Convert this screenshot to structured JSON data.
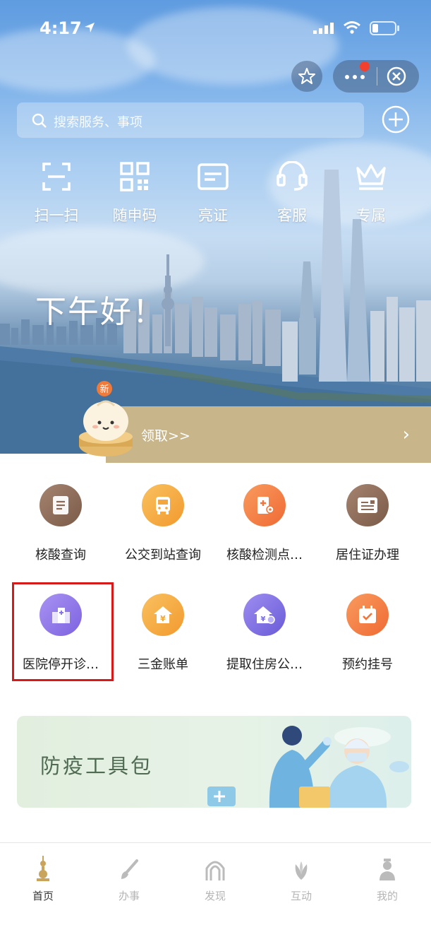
{
  "status_bar": {
    "time": "4:17"
  },
  "search": {
    "placeholder": "搜索服务、事项"
  },
  "quick_actions": [
    {
      "label": "扫一扫",
      "icon": "scan-icon"
    },
    {
      "label": "随申码",
      "icon": "qr-code-icon"
    },
    {
      "label": "亮证",
      "icon": "id-card-icon"
    },
    {
      "label": "客服",
      "icon": "headset-icon"
    },
    {
      "label": "专属",
      "icon": "crown-icon"
    }
  ],
  "greeting": "下午好！",
  "banner": {
    "badge": "新",
    "text": "领取>>",
    "chevron": "›"
  },
  "services": [
    {
      "label": "核酸查询",
      "icon": "document-list-icon",
      "color": "#8b6b57"
    },
    {
      "label": "公交到站查询",
      "icon": "bus-icon",
      "color": "#f4a73e"
    },
    {
      "label": "核酸检测点…",
      "icon": "clinic-location-icon",
      "color": "#f2763b"
    },
    {
      "label": "居住证办理",
      "icon": "id-card-icon",
      "color": "#8b6b57"
    },
    {
      "label": "医院停开诊…",
      "icon": "hospital-icon",
      "color": "#8c74e6"
    },
    {
      "label": "三金账单",
      "icon": "yuan-bill-icon",
      "color": "#f4a73e"
    },
    {
      "label": "提取住房公…",
      "icon": "house-fund-icon",
      "color": "#7b6fe0"
    },
    {
      "label": "预约挂号",
      "icon": "calendar-check-icon",
      "color": "#f2763b"
    }
  ],
  "tools_banner": {
    "title": "防疫工具包"
  },
  "tabs": [
    {
      "label": "首页",
      "icon": "home-tower-icon",
      "active": true
    },
    {
      "label": "办事",
      "icon": "brush-icon",
      "active": false
    },
    {
      "label": "发现",
      "icon": "arch-icon",
      "active": false
    },
    {
      "label": "互动",
      "icon": "magnolia-icon",
      "active": false
    },
    {
      "label": "我的",
      "icon": "person-icon",
      "active": false
    }
  ],
  "colors": {
    "accent": "#c8b58a",
    "highlight": "#d61a1a",
    "tab_active": "#333333",
    "tab_inactive": "#b5b5b5"
  }
}
